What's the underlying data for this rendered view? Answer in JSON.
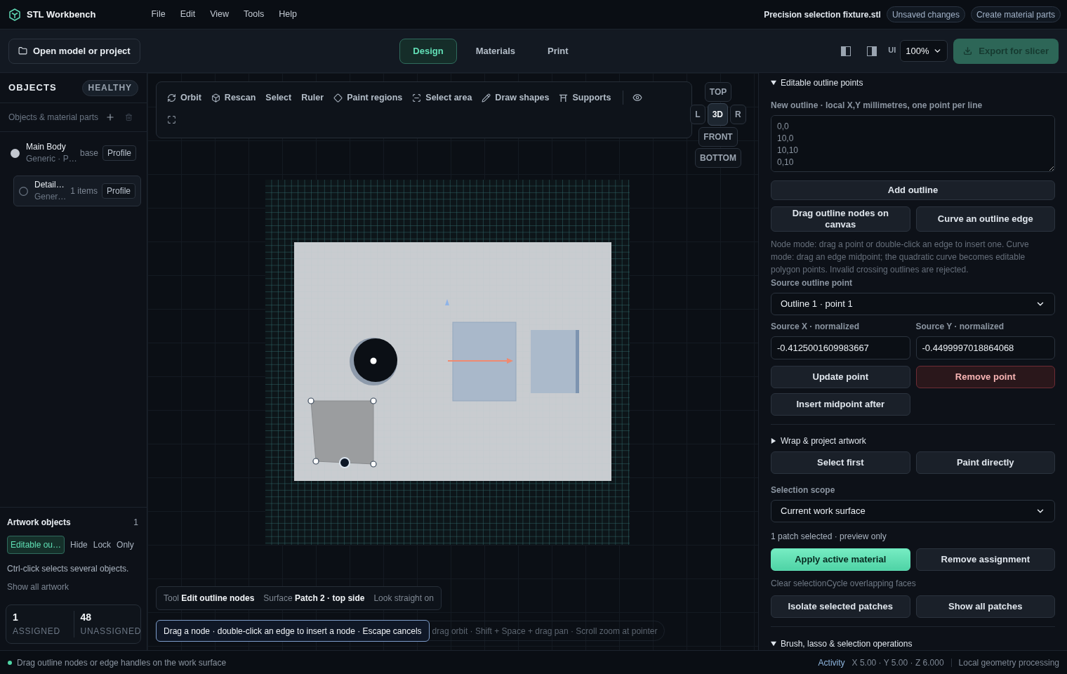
{
  "app": {
    "name": "STL Workbench"
  },
  "menu": [
    "File",
    "Edit",
    "View",
    "Tools",
    "Help"
  ],
  "document": {
    "file_name": "Precision selection fixture.stl",
    "status": "Unsaved changes",
    "action": "Create material parts"
  },
  "toolbar": {
    "open_button": "Open model or project",
    "modes": [
      {
        "label": "Design",
        "selected": true
      },
      {
        "label": "Materials",
        "selected": false
      },
      {
        "label": "Print",
        "selected": false
      }
    ],
    "ui_label": "UI",
    "ui_scale": "100%",
    "export_button": "Export for slicer"
  },
  "objects_panel": {
    "title": "OBJECTS",
    "health": "HEALTHY",
    "subtitle": "Objects & material parts",
    "items": [
      {
        "name": "Main Body",
        "detail": "Generic · P…",
        "tag": "base",
        "button": "Profile",
        "active": true,
        "selected": false,
        "children": [
          {
            "name": "Detail…",
            "detail": "Gener…",
            "tag": "1 items",
            "button": "Profile",
            "active": false,
            "selected": true
          }
        ]
      }
    ]
  },
  "artwork_panel": {
    "title": "Artwork objects",
    "count": "1",
    "items": [
      {
        "label": "Editable ou…",
        "selected": true
      }
    ],
    "actions": [
      "Hide",
      "Lock",
      "Only"
    ],
    "hint": "Ctrl-click selects several objects.",
    "link": "Show all artwork",
    "stats": [
      {
        "value": "1",
        "label": "ASSIGNED"
      },
      {
        "value": "48",
        "label": "UNASSIGNED"
      }
    ]
  },
  "viewport": {
    "tools": [
      "Orbit",
      "Rescan",
      "Select",
      "Ruler",
      "Paint regions",
      "Select area",
      "Draw shapes",
      "Supports"
    ],
    "view_rows": [
      {
        "buttons": [
          {
            "label": "TOP",
            "selected": false
          }
        ]
      },
      {
        "buttons": [
          {
            "label": "L",
            "selected": false
          },
          {
            "label": "3D",
            "selected": true
          },
          {
            "label": "R",
            "selected": false
          }
        ]
      },
      {
        "buttons": [
          {
            "label": "FRONT",
            "selected": false
          }
        ]
      },
      {
        "buttons": [
          {
            "label": "BOTTOM",
            "selected": false
          }
        ]
      }
    ],
    "info": {
      "tool_label": "Tool",
      "tool": "Edit outline nodes",
      "surface_label": "Surface",
      "surface": "Patch 2 · top side",
      "view": "Look straight on"
    },
    "hint": "Drag a node · double-click an edge to insert a node · Escape cancels",
    "shortcuts": "drag orbit · Shift + Space + drag pan · Scroll zoom at pointer"
  },
  "inspector": {
    "outline_section": {
      "title": "Editable outline points",
      "expanded": true,
      "field_label": "New outline · local X,Y millimetres, one point per line",
      "field_placeholder": "0,0\n10,0\n10,10\n0,10",
      "add_button": "Add outline",
      "edit_modes": [
        "Drag outline nodes on canvas",
        "Curve an outline edge"
      ],
      "note": "Node mode: drag a point or double-click an edge to insert one. Curve mode: drag an edge midpoint; the quadratic curve becomes editable polygon points. Invalid crossing outlines are rejected.",
      "point_label": "Source outline point",
      "point_value": "Outline 1 · point 1",
      "x_label": "Source X · normalized",
      "x_value": "-0.4125001609983667",
      "y_label": "Source Y · normalized",
      "y_value": "-0.4499997018864068",
      "point_actions": [
        {
          "label": "Update point",
          "kind": "normal"
        },
        {
          "label": "Remove point",
          "kind": "danger"
        },
        {
          "label": "Insert midpoint after",
          "kind": "normal"
        }
      ]
    },
    "wrap_section": {
      "title": "Wrap & project artwork",
      "expanded": false
    },
    "selection": {
      "modes": [
        "Select first",
        "Paint directly"
      ],
      "scope_label": "Selection scope",
      "scope_value": "Current work surface",
      "summary": "1 patch selected · preview only",
      "actions": [
        {
          "label": "Apply active material",
          "kind": "primary"
        },
        {
          "label": "Remove assignment",
          "kind": "normal"
        }
      ],
      "links": [
        "Clear selection",
        "Cycle overlapping faces"
      ],
      "patch_actions": [
        "Isolate selected patches",
        "Show all patches"
      ]
    },
    "brush_section": {
      "title": "Brush, lasso & selection operations",
      "expanded": true
    }
  },
  "status_bar": {
    "message": "Drag outline nodes or edge handles on the work surface",
    "activity": "Activity",
    "coordinates": "X 5.00 · Y 5.00 · Z 6.000",
    "engine": "Local geometry processing"
  }
}
